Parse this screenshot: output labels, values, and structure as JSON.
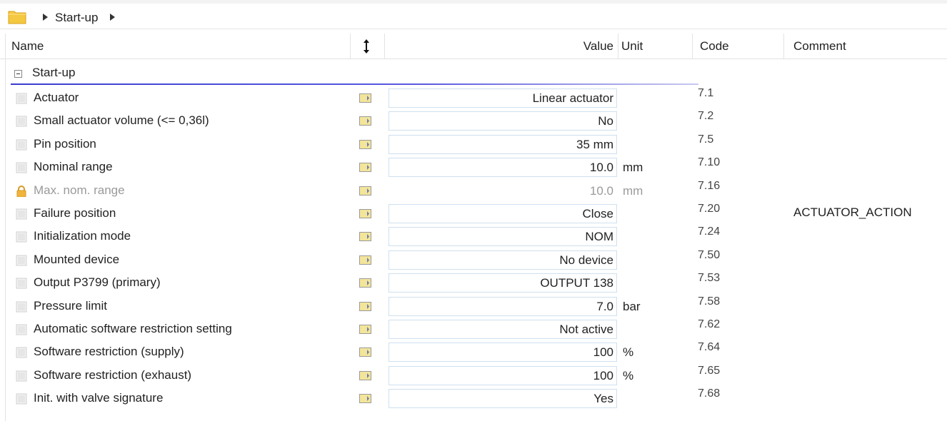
{
  "breadcrumb": {
    "folder_icon": "folder-icon",
    "arrow_icon": "triangle-right-icon",
    "label": "Start-up"
  },
  "header": {
    "name": "Name",
    "sort_icon": "sort-arrows-icon",
    "value": "Value",
    "unit": "Unit",
    "code": "Code",
    "comment": "Comment"
  },
  "group": {
    "toggle_icon": "collapse-minus-icon",
    "label": "Start-up"
  },
  "rows": [
    {
      "name": "Actuator",
      "icon": "parameter-icon",
      "flag_icon": "flag-icon",
      "value": "Linear actuator",
      "unit": "",
      "code": "7.1",
      "comment": "",
      "locked": false,
      "editable": true
    },
    {
      "name": "Small actuator volume (<= 0,36l)",
      "icon": "parameter-icon",
      "flag_icon": "flag-icon",
      "value": "No",
      "unit": "",
      "code": "7.2",
      "comment": "",
      "locked": false,
      "editable": true
    },
    {
      "name": "Pin position",
      "icon": "parameter-icon",
      "flag_icon": "flag-icon",
      "value": "35 mm",
      "unit": "",
      "code": "7.5",
      "comment": "",
      "locked": false,
      "editable": true
    },
    {
      "name": "Nominal range",
      "icon": "parameter-icon",
      "flag_icon": "flag-icon",
      "value": "10.0",
      "unit": "mm",
      "code": "7.10",
      "comment": "",
      "locked": false,
      "editable": true
    },
    {
      "name": "Max. nom. range",
      "icon": "lock-icon",
      "flag_icon": "flag-icon",
      "value": "10.0",
      "unit": "mm",
      "code": "7.16",
      "comment": "",
      "locked": true,
      "editable": false
    },
    {
      "name": "Failure position",
      "icon": "parameter-icon",
      "flag_icon": "flag-icon",
      "value": "Close",
      "unit": "",
      "code": "7.20",
      "comment": "ACTUATOR_ACTION",
      "locked": false,
      "editable": true
    },
    {
      "name": "Initialization mode",
      "icon": "parameter-icon",
      "flag_icon": "flag-icon",
      "value": "NOM",
      "unit": "",
      "code": "7.24",
      "comment": "",
      "locked": false,
      "editable": true
    },
    {
      "name": "Mounted device",
      "icon": "parameter-icon",
      "flag_icon": "flag-icon",
      "value": "No device",
      "unit": "",
      "code": "7.50",
      "comment": "",
      "locked": false,
      "editable": true
    },
    {
      "name": "Output P3799 (primary)",
      "icon": "parameter-icon",
      "flag_icon": "flag-icon",
      "value": "OUTPUT 138",
      "unit": "",
      "code": "7.53",
      "comment": "",
      "locked": false,
      "editable": true
    },
    {
      "name": "Pressure limit",
      "icon": "parameter-icon",
      "flag_icon": "flag-icon",
      "value": "7.0",
      "unit": "bar",
      "code": "7.58",
      "comment": "",
      "locked": false,
      "editable": true
    },
    {
      "name": "Automatic software restriction setting",
      "icon": "parameter-icon",
      "flag_icon": "flag-icon",
      "value": "Not active",
      "unit": "",
      "code": "7.62",
      "comment": "",
      "locked": false,
      "editable": true
    },
    {
      "name": "Software restriction (supply)",
      "icon": "parameter-icon",
      "flag_icon": "flag-icon",
      "value": "100",
      "unit": "%",
      "code": "7.64",
      "comment": "",
      "locked": false,
      "editable": true
    },
    {
      "name": "Software restriction (exhaust)",
      "icon": "parameter-icon",
      "flag_icon": "flag-icon",
      "value": "100",
      "unit": "%",
      "code": "7.65",
      "comment": "",
      "locked": false,
      "editable": true
    },
    {
      "name": "Init. with valve signature",
      "icon": "parameter-icon",
      "flag_icon": "flag-icon",
      "value": "Yes",
      "unit": "",
      "code": "7.68",
      "comment": "",
      "locked": false,
      "editable": true
    }
  ],
  "colors": {
    "group_underline": "#3c3cd2",
    "value_box_border": "#cfe0ef",
    "flag_fill": "#f3e59a",
    "lock_color": "#e3a22b"
  }
}
